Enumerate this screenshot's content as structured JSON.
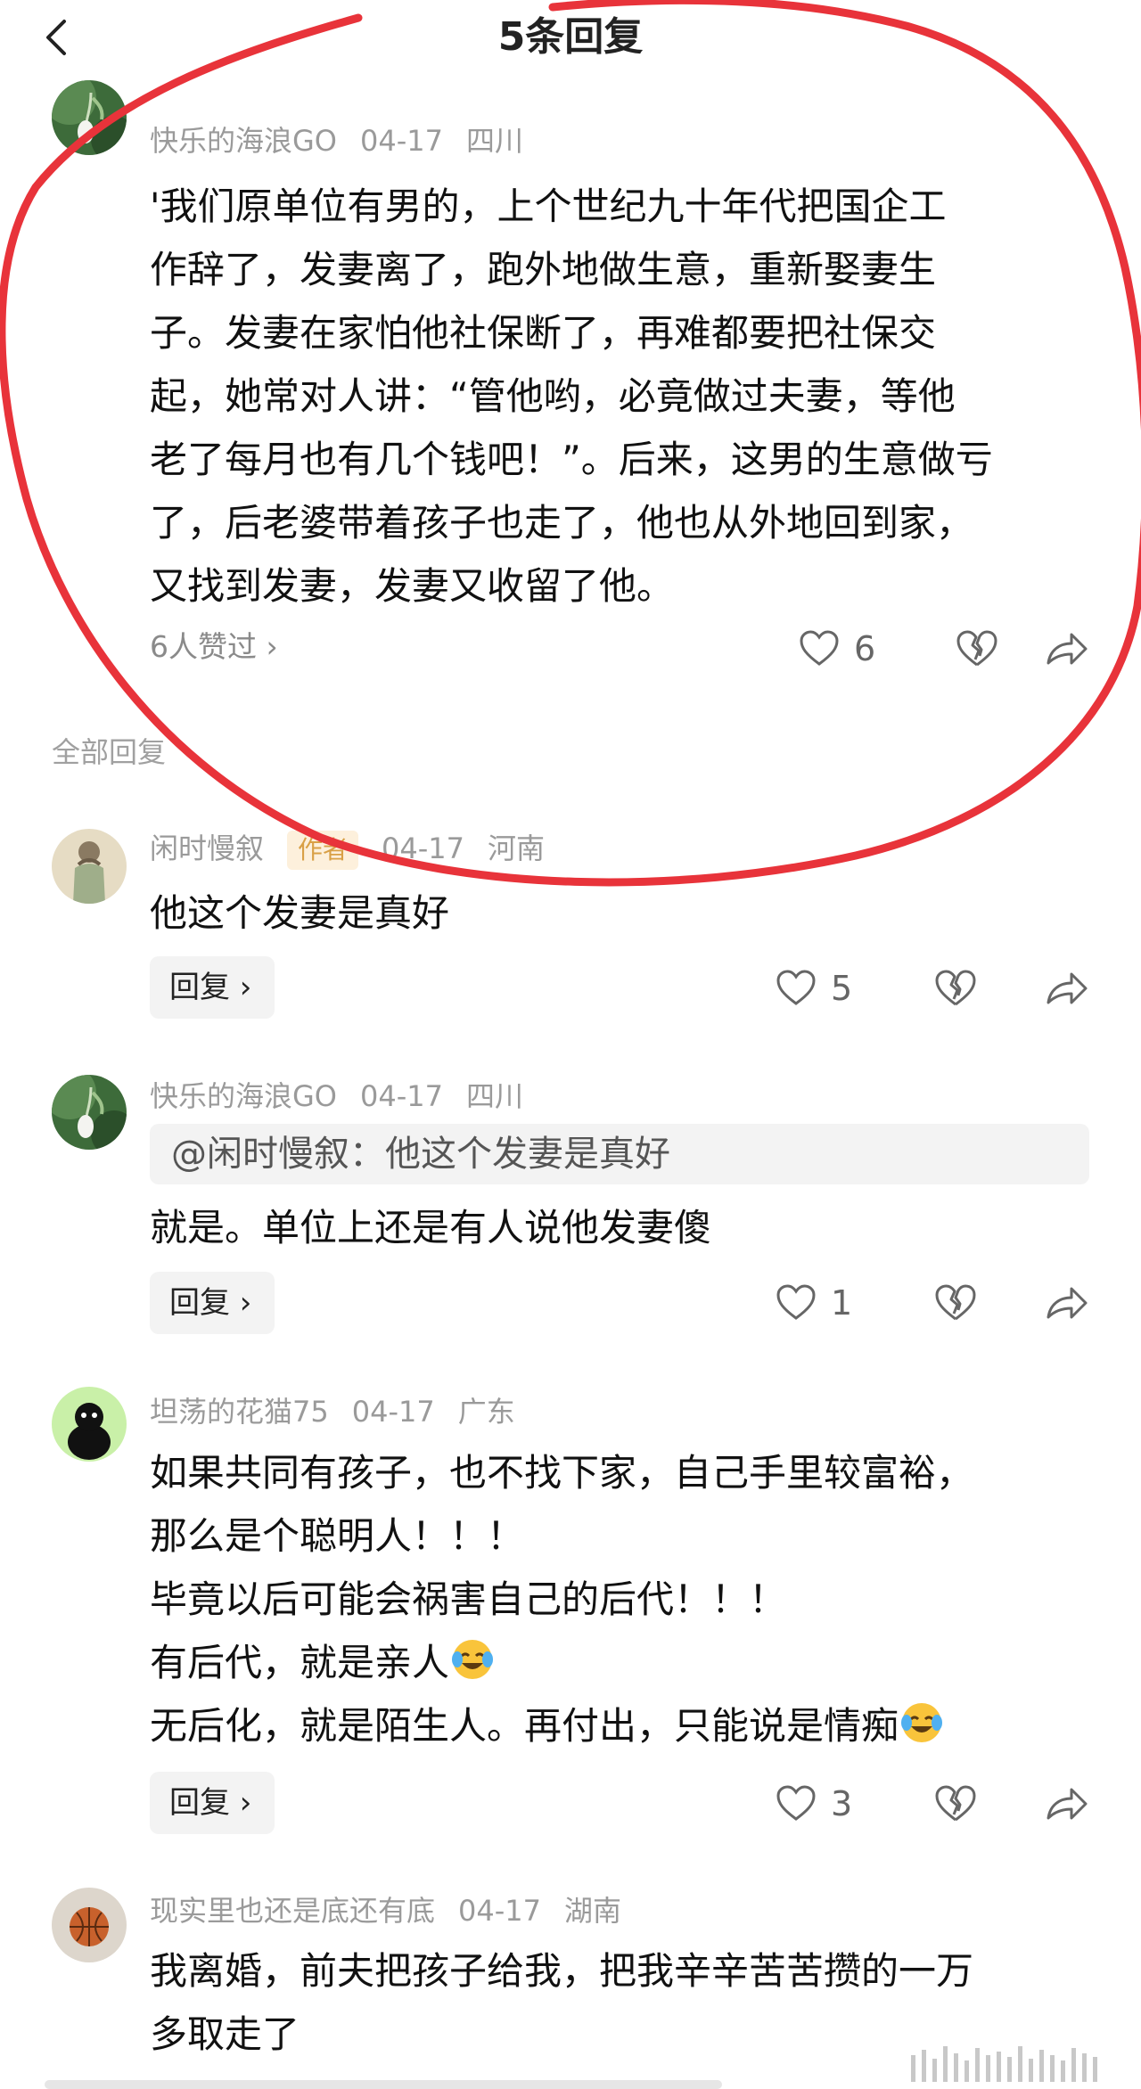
{
  "header": {
    "title": "5条回复"
  },
  "main_comment": {
    "user": "快乐的海浪GO",
    "date": "04-17",
    "location": "四川",
    "lines": [
      "'我们原单位有男的，上个世纪九十年代把国企工",
      "作辞了，发妻离了，跑外地做生意，重新娶妻生",
      "子。发妻在家怕他社保断了，再难都要把社保交",
      "起，她常对人讲：“管他哟，必竟做过夫妻，等他",
      "老了每月也有几个钱吧！”。后来，这男的生意做亏",
      "了，后老婆带着孩子也走了，他也从外地回到家，",
      "又找到发妻，发妻又收留了他。"
    ],
    "likes_link": "6人赞过 ›",
    "like_count": "6"
  },
  "section_label": "全部回复",
  "replies": [
    {
      "user": "闲时慢叙",
      "badge": "作者",
      "date": "04-17",
      "location": "河南",
      "lines": [
        "他这个发妻是真好"
      ],
      "reply_label": "回复 ›",
      "like_count": "5"
    },
    {
      "user": "快乐的海浪GO",
      "date": "04-17",
      "location": "四川",
      "quote": "@闲时慢叙：他这个发妻是真好",
      "lines": [
        "就是。单位上还是有人说他发妻傻"
      ],
      "reply_label": "回复 ›",
      "like_count": "1"
    },
    {
      "user": "坦荡的花猫75",
      "date": "04-17",
      "location": "广东",
      "lines": [
        "如果共同有孩子，也不找下家，自己手里较富裕，",
        "那么是个聪明人！！！",
        "毕竟以后可能会祸害自己的后代！！！",
        "有后代，就是亲人",
        "无后化，就是陌生人。再付出，只能说是情痴"
      ],
      "emoji_name": "laughing-crying-emoji",
      "reply_label": "回复 ›",
      "like_count": "3"
    },
    {
      "user": "现实里也还是底还有底",
      "date": "04-17",
      "location": "湖南",
      "lines": [
        "我离婚，前夫把孩子给我，把我辛辛苦苦攒的一万",
        "多取走了"
      ]
    }
  ],
  "colors": {
    "annotation_red": "#e8333a",
    "meta_gray": "#9a9a9a",
    "badge_bg": "#fdf0dc",
    "badge_text": "#d9a046"
  },
  "icons": [
    "back-arrow-icon",
    "heart-icon",
    "broken-heart-icon",
    "share-icon"
  ]
}
